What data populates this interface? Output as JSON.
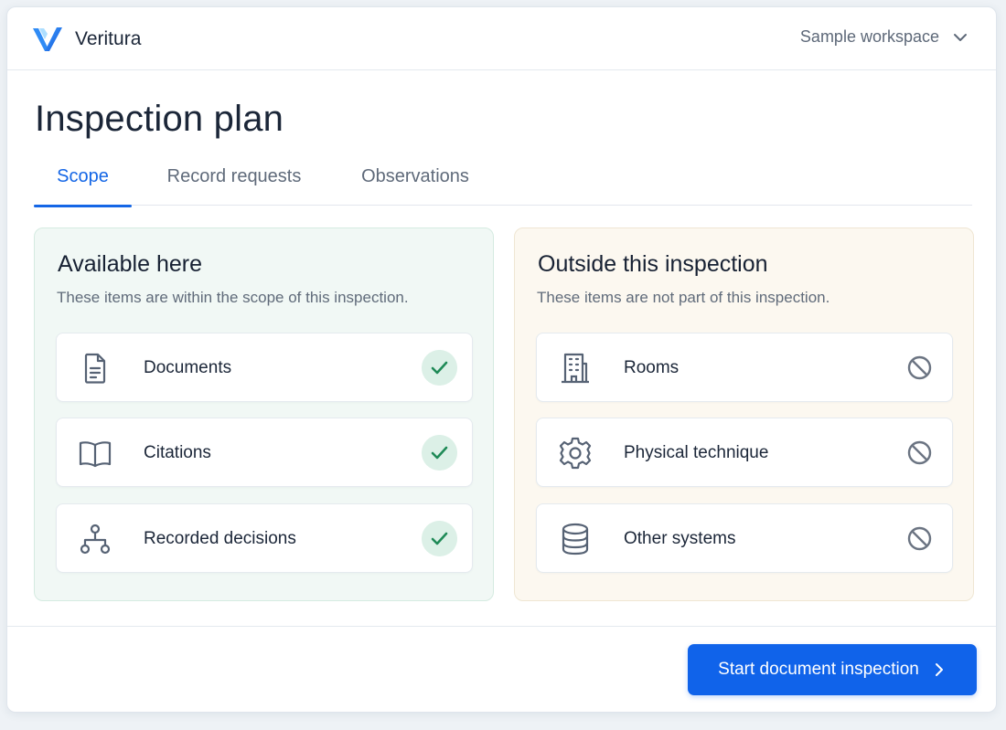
{
  "app": {
    "name": "Veritura",
    "logo_icon": "veritura-logo-icon",
    "accent": "#1466e6"
  },
  "header": {
    "workspace_label": "Sample workspace"
  },
  "page": {
    "title": "Inspection plan"
  },
  "tabs": [
    {
      "label": "Scope",
      "active": true
    },
    {
      "label": "Record requests",
      "active": false
    },
    {
      "label": "Observations",
      "active": false
    }
  ],
  "in_scope": {
    "title": "Available here",
    "subtitle": "These items are within the scope of this inspection.",
    "color": "#f1f8f5",
    "items": [
      {
        "label": "Documents",
        "icon": "document-icon",
        "status": "included"
      },
      {
        "label": "Citations",
        "icon": "book-icon",
        "status": "included"
      },
      {
        "label": "Recorded decisions",
        "icon": "decision-tree-icon",
        "status": "included"
      }
    ]
  },
  "out_of_scope": {
    "title": "Outside this inspection",
    "subtitle": "These items are not part of this inspection.",
    "color": "#fcf8f0",
    "items": [
      {
        "label": "Rooms",
        "icon": "building-icon",
        "status": "excluded"
      },
      {
        "label": "Physical technique",
        "icon": "gear-icon",
        "status": "excluded"
      },
      {
        "label": "Other systems",
        "icon": "database-icon",
        "status": "excluded"
      }
    ]
  },
  "footer": {
    "cta_label": "Start document inspection",
    "cta_color": "#1063ea"
  }
}
